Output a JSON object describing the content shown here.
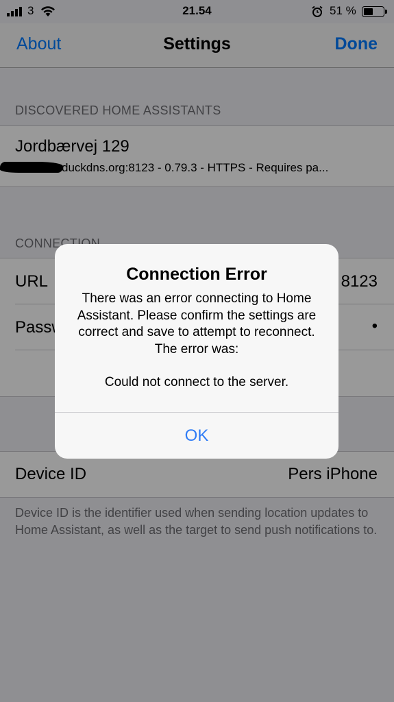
{
  "status_bar": {
    "carrier": "3",
    "time": "21.54",
    "battery_text": "51 %",
    "battery_level": 0.51
  },
  "nav": {
    "left_label": "About",
    "title": "Settings",
    "right_label": "Done"
  },
  "discovered": {
    "header": "DISCOVERED HOME ASSISTANTS",
    "items": [
      {
        "name": "Jordbærvej 129",
        "detail": "duckdns.org:8123 - 0.79.3 - HTTPS  - Requires pa..."
      }
    ]
  },
  "connection": {
    "header": "CONNECTION",
    "url_label": "URL",
    "url_value": "8123",
    "password_label": "Passw",
    "password_value": "•"
  },
  "device": {
    "id_label": "Device ID",
    "id_value": "Pers iPhone",
    "footer": "Device ID is the identifier used when sending location updates to Home Assistant, as well as the target to send push notifications to."
  },
  "alert": {
    "title": "Connection Error",
    "message": "There was an error connecting to Home Assistant. Please confirm the settings are correct and save to attempt to reconnect. The error was:",
    "error": "Could not connect to the server.",
    "ok_label": "OK"
  },
  "colors": {
    "accent": "#007aff",
    "alert_button": "#2f7cf6"
  }
}
